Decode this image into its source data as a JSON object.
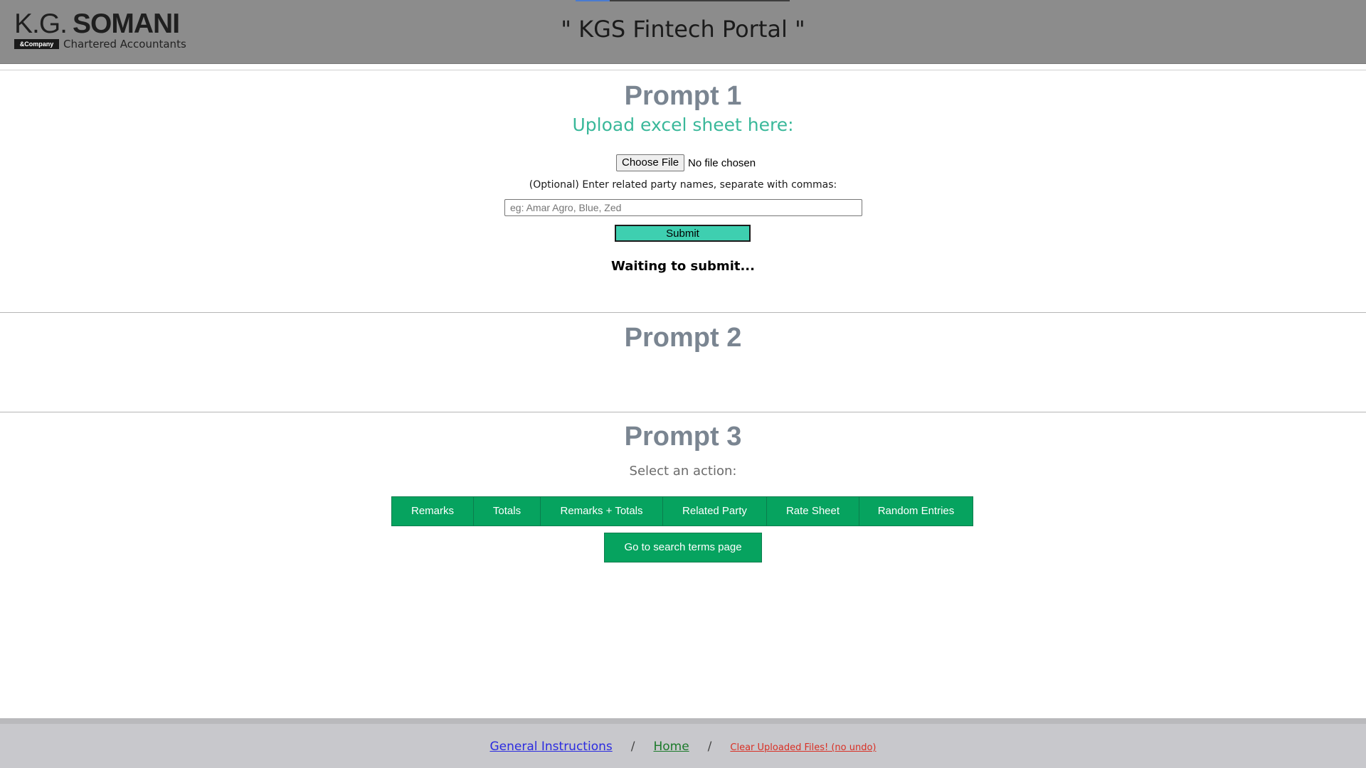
{
  "header": {
    "logo_kg": "K.G.",
    "logo_somani": "SOMANI",
    "logo_company": "&Company",
    "logo_tagline": "Chartered Accountants",
    "title": "\" KGS Fintech Portal \"",
    "progress_fraction": 0.16
  },
  "prompt1": {
    "heading": "Prompt 1",
    "subheading": "Upload excel sheet here:",
    "choose_file_label": "Choose File",
    "file_status": "No file chosen",
    "optional_label": "(Optional) Enter related party names, separate with commas:",
    "party_input_placeholder": "eg: Amar Agro, Blue, Zed",
    "party_input_value": "",
    "submit_label": "Submit",
    "status": "Waiting to submit..."
  },
  "prompt2": {
    "heading": "Prompt 2"
  },
  "prompt3": {
    "heading": "Prompt 3",
    "select_label": "Select an action:",
    "actions": [
      {
        "label": "Remarks"
      },
      {
        "label": "Totals"
      },
      {
        "label": "Remarks + Totals"
      },
      {
        "label": "Related Party"
      },
      {
        "label": "Rate Sheet"
      },
      {
        "label": "Random Entries"
      }
    ],
    "search_terms_label": "Go to search terms page"
  },
  "footer": {
    "instructions_link": "General Instructions",
    "home_link": "Home",
    "clear_link": "Clear Uploaded Files! (no undo)",
    "separator": "/"
  },
  "colors": {
    "header_bg": "#8c8c8c",
    "accent_teal": "#3ab89a",
    "submit_bg": "#3ecfb0",
    "action_green": "#06a35f",
    "heading_gray": "#7a8591",
    "footer_bg": "#c8c8cc"
  }
}
